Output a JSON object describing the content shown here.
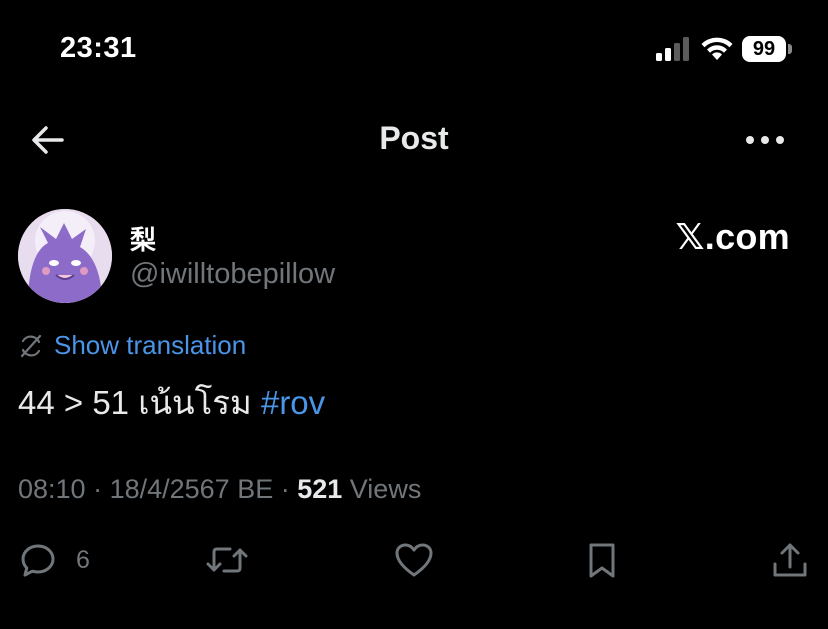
{
  "status_bar": {
    "time": "23:31",
    "battery": "99"
  },
  "header": {
    "title": "Post"
  },
  "author": {
    "name": "梨",
    "handle": "@iwilltobepillow"
  },
  "brand": {
    "logo_letter": "𝕏",
    "logo_suffix": ".com"
  },
  "post": {
    "translate_label": "Show translation",
    "text": "44 > 51 เน้นโรม ",
    "hashtag": "#rov"
  },
  "meta": {
    "time": "08:10",
    "sep1": " · ",
    "date": "18/4/2567 BE",
    "sep2": " · ",
    "views_count": "521",
    "views_label": " Views"
  },
  "actions": {
    "reply_count": "6"
  },
  "colors": {
    "background": "#000000",
    "text": "#e7e9ea",
    "muted": "#71767b",
    "link": "#4b95e9"
  },
  "icons": [
    "signal-icon",
    "wifi-icon",
    "battery-icon",
    "back-arrow-icon",
    "more-icon",
    "translate-icon",
    "reply-icon",
    "repost-icon",
    "like-icon",
    "bookmark-icon",
    "share-icon"
  ]
}
